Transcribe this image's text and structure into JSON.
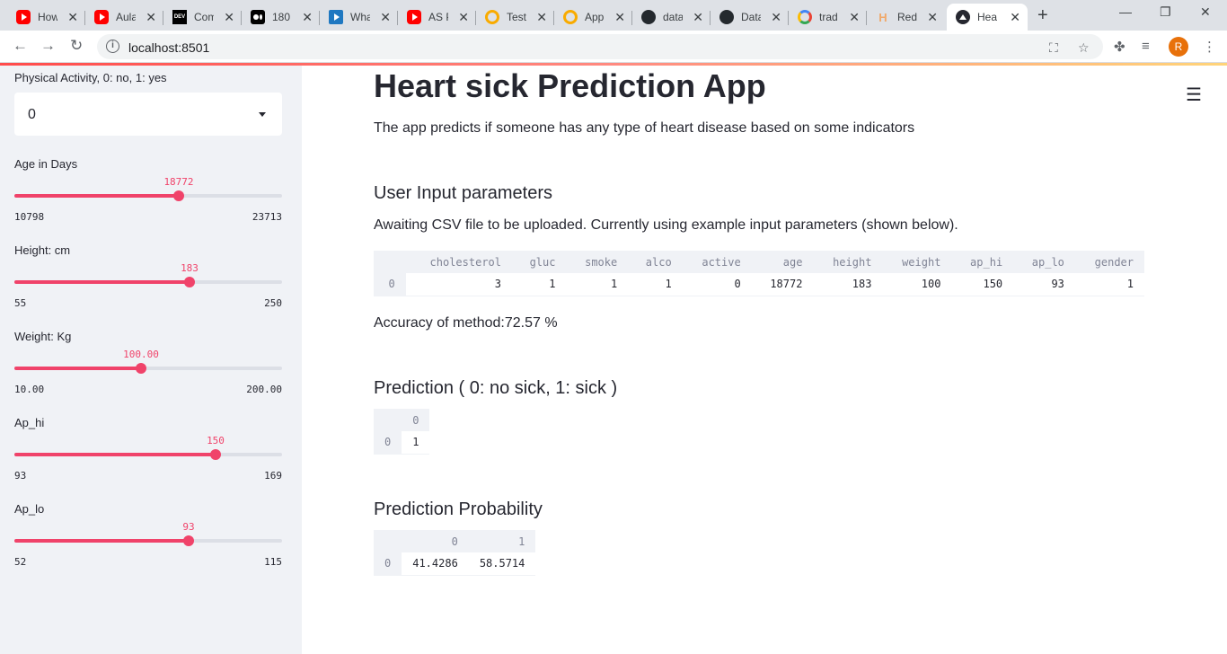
{
  "browser": {
    "tabs": [
      {
        "title": "How",
        "icon": "youtube-icon"
      },
      {
        "title": "Aula",
        "icon": "youtube-icon"
      },
      {
        "title": "Com",
        "icon": "dev-icon"
      },
      {
        "title": "180",
        "icon": "medium-icon"
      },
      {
        "title": "Wha",
        "icon": "video-icon"
      },
      {
        "title": "AS P",
        "icon": "youtube-icon"
      },
      {
        "title": "Test",
        "icon": "colab-icon"
      },
      {
        "title": "App",
        "icon": "colab-icon"
      },
      {
        "title": "data",
        "icon": "github-icon"
      },
      {
        "title": "Data",
        "icon": "github-icon"
      },
      {
        "title": "trad",
        "icon": "google-icon"
      },
      {
        "title": "Rede",
        "icon": "h-icon"
      },
      {
        "title": "Hear",
        "icon": "streamlit-icon"
      }
    ],
    "url": "localhost:8501",
    "avatar_letter": "R",
    "accent": "#f0436a"
  },
  "sidebar": {
    "select": {
      "label": "Physical Activity, 0: no, 1: yes",
      "value": "0"
    },
    "sliders": [
      {
        "label": "Age in Days",
        "value": "18772",
        "min": "10798",
        "max": "23713",
        "fraction": 0.615
      },
      {
        "label": "Height: cm",
        "value": "183",
        "min": "55",
        "max": "250",
        "fraction": 0.656
      },
      {
        "label": "Weight: Kg",
        "value": "100.00",
        "min": "10.00",
        "max": "200.00",
        "fraction": 0.474
      },
      {
        "label": "Ap_hi",
        "value": "150",
        "min": "93",
        "max": "169",
        "fraction": 0.75
      },
      {
        "label": "Ap_lo",
        "value": "93",
        "min": "52",
        "max": "115",
        "fraction": 0.651
      }
    ]
  },
  "main": {
    "title": "Heart sick Prediction App",
    "description": "The app predicts if someone has any type of heart disease based on some indicators",
    "input_header": "User Input parameters",
    "input_note": "Awaiting CSV file to be uploaded. Currently using example input parameters (shown below).",
    "input_table": {
      "columns": [
        "cholesterol",
        "gluc",
        "smoke",
        "alco",
        "active",
        "age",
        "height",
        "weight",
        "ap_hi",
        "ap_lo",
        "gender"
      ],
      "index": "0",
      "values": [
        "3",
        "1",
        "1",
        "1",
        "0",
        "18772",
        "183",
        "100",
        "150",
        "93",
        "1"
      ]
    },
    "accuracy": "Accuracy of method:72.57 %",
    "prediction_header": "Prediction ( 0: no sick, 1: sick )",
    "prediction_table": {
      "columns": [
        "0"
      ],
      "index": "0",
      "values": [
        "1"
      ]
    },
    "probability_header": "Prediction Probability",
    "probability_table": {
      "columns": [
        "0",
        "1"
      ],
      "index": "0",
      "values": [
        "41.4286",
        "58.5714"
      ]
    }
  }
}
